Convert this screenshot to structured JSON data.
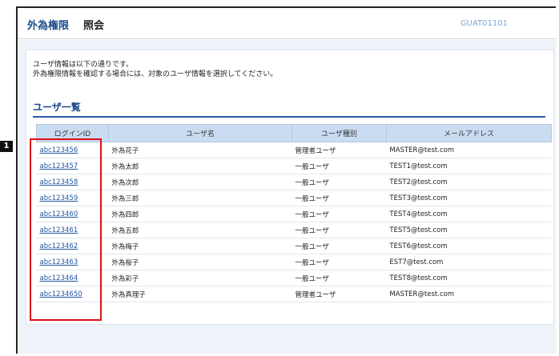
{
  "header": {
    "section": "外為権限",
    "action": "照会",
    "screen_code": "GUAT01101"
  },
  "intro": {
    "line1": "ユーザ情報は以下の通りです。",
    "line2": "外為権限情報を確認する場合には、対象のユーザ情報を選択してください。"
  },
  "list_title": "ユーザ一覧",
  "table": {
    "headers": {
      "login": "ログインID",
      "name": "ユーザ名",
      "type": "ユーザ種別",
      "mail": "メールアドレス"
    },
    "rows": [
      {
        "login": "abc123456",
        "name": "外為花子",
        "type": "管理者ユーザ",
        "mail": "MASTER@test.com"
      },
      {
        "login": "abc123457",
        "name": "外為太郎",
        "type": "一般ユーザ",
        "mail": "TEST1@test.com"
      },
      {
        "login": "abc123458",
        "name": "外為次郎",
        "type": "一般ユーザ",
        "mail": "TEST2@test.com"
      },
      {
        "login": "abc123459",
        "name": "外為三郎",
        "type": "一般ユーザ",
        "mail": "TEST3@test.com"
      },
      {
        "login": "abc123460",
        "name": "外為四郎",
        "type": "一般ユーザ",
        "mail": "TEST4@test.com"
      },
      {
        "login": "abc123461",
        "name": "外為五郎",
        "type": "一般ユーザ",
        "mail": "TEST5@test.com"
      },
      {
        "login": "abc123462",
        "name": "外為梅子",
        "type": "一般ユーザ",
        "mail": "TEST6@test.com"
      },
      {
        "login": "abc123463",
        "name": "外為桜子",
        "type": "一般ユーザ",
        "mail": "EST7@test.com"
      },
      {
        "login": "abc123464",
        "name": "外為彩子",
        "type": "一般ユーザ",
        "mail": "TEST8@test.com"
      },
      {
        "login": "abc1234650",
        "name": "外為真理子",
        "type": "管理者ユーザ",
        "mail": "MASTER@test.com"
      }
    ]
  },
  "annotation": {
    "marker": "1"
  }
}
